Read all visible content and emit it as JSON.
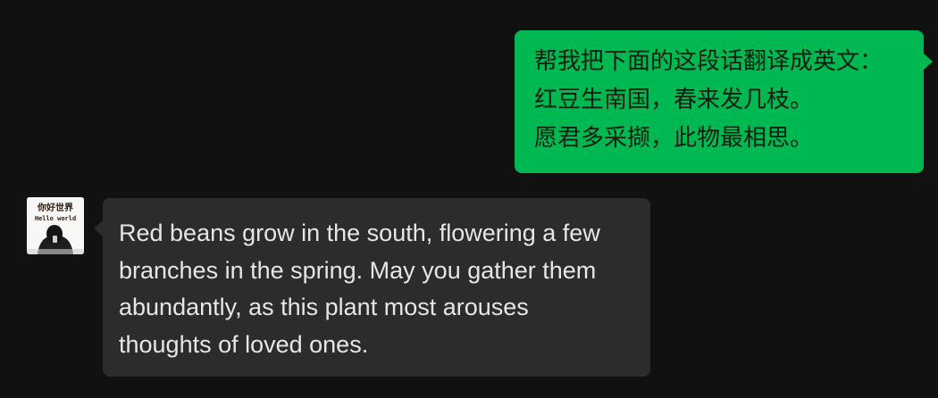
{
  "messages": {
    "sent": {
      "lines": [
        "帮我把下面的这段话翻译成英文：",
        "红豆生南国，春来发几枝。",
        "愿君多采撷，此物最相思。"
      ]
    },
    "received": {
      "lines": [
        "Red beans grow in the south, flowering a few",
        "branches in the spring. May you gather them",
        "abundantly, as this plant most arouses",
        "thoughts of loved ones."
      ]
    }
  },
  "avatar": {
    "title_text": "你好世界",
    "subtitle_text": "Hello world"
  },
  "colors": {
    "background": "#111111",
    "sent_bubble": "#00b852",
    "received_bubble": "#2c2c2c",
    "received_text": "#e6e6e6"
  }
}
